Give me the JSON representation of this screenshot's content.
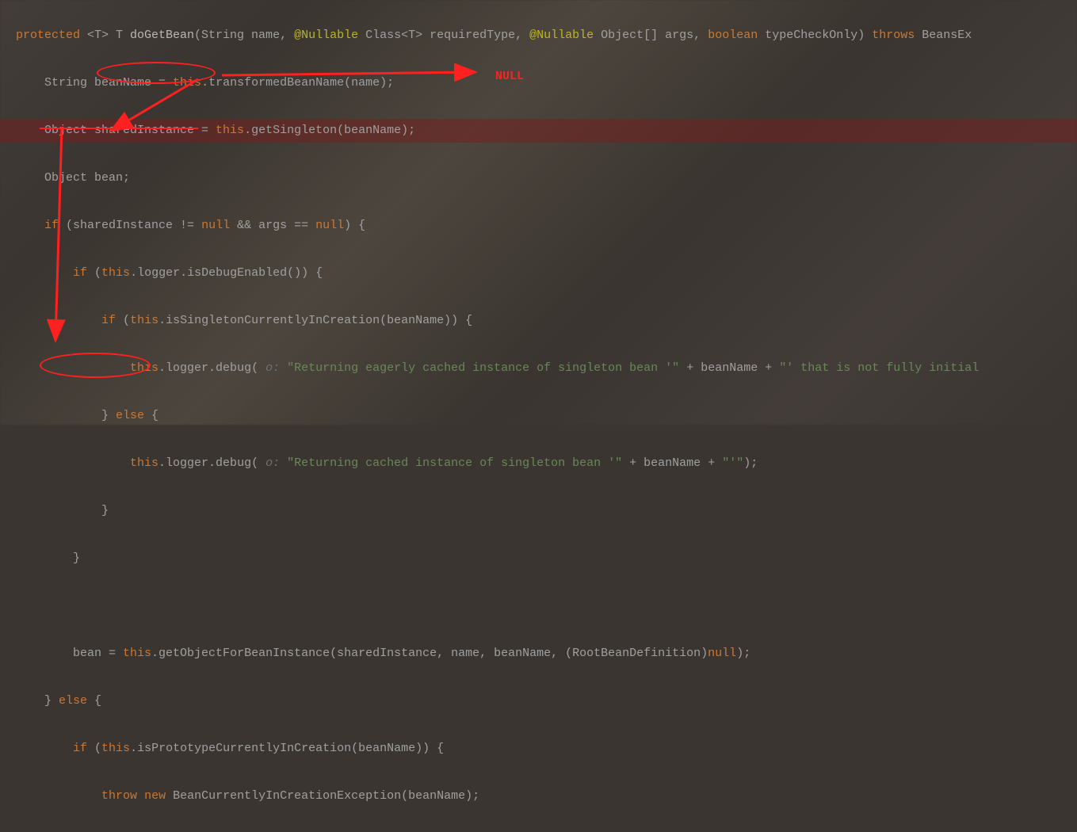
{
  "annotations": {
    "null_label": "NULL"
  },
  "code": {
    "l1": {
      "kw_protected": "protected",
      "gen_open": " <T> T ",
      "method": "doGetBean",
      "paren": "(String name, ",
      "ann1": "@Nullable",
      "p2": " Class<T> requiredType, ",
      "ann2": "@Nullable",
      "p3": " Object[] args, ",
      "kw_bool": "boolean",
      "p4": " typeCheckOnly) ",
      "kw_throws": "throws",
      "ex": " BeansEx"
    },
    "l2": {
      "pre": "    String beanName = ",
      "kw_this": "this",
      "rest": ".transformedBeanName(name);"
    },
    "l3": {
      "pre": "    Object sharedInstance = ",
      "kw_this": "this",
      "rest": ".getSingleton(beanName);"
    },
    "l4": {
      "txt": "    Object bean;"
    },
    "l5": {
      "pre": "    ",
      "kw_if": "if",
      "p1": " (sharedInstance != ",
      "kw_null": "null",
      "p2": " && args == ",
      "kw_null2": "null",
      "p3": ") {"
    },
    "l6": {
      "pre": "        ",
      "kw_if": "if",
      "p1": " (",
      "kw_this": "this",
      "rest": ".logger.isDebugEnabled()) {"
    },
    "l7": {
      "pre": "            ",
      "kw_if": "if",
      "p1": " (",
      "kw_this": "this",
      "rest": ".isSingletonCurrentlyInCreation(beanName)) {"
    },
    "l8": {
      "pre": "                ",
      "kw_this": "this",
      "p1": ".logger.debug(",
      "hint": " o: ",
      "str": "\"Returning eagerly cached instance of singleton bean '\"",
      "p2": " + beanName + ",
      "str2": "\"' that is not fully initial"
    },
    "l9": {
      "pre": "            } ",
      "kw_else": "else",
      "rest": " {"
    },
    "l10": {
      "pre": "                ",
      "kw_this": "this",
      "p1": ".logger.debug(",
      "hint": " o: ",
      "str": "\"Returning cached instance of singleton bean '\"",
      "p2": " + beanName + ",
      "str2": "\"'\"",
      "rest": ");"
    },
    "l11": {
      "txt": "            }"
    },
    "l12": {
      "txt": "        }"
    },
    "l13": {
      "txt": ""
    },
    "l14": {
      "pre": "        bean = ",
      "kw_this": "this",
      "p1": ".getObjectForBeanInstance(sharedInstance, name, beanName, (RootBeanDefinition)",
      "kw_null": "null",
      "rest": ");"
    },
    "l15": {
      "pre": "    } ",
      "kw_else": "else",
      "rest": " {"
    },
    "l16": {
      "pre": "        ",
      "kw_if": "if",
      "p1": " (",
      "kw_this": "this",
      "rest": ".isPrototypeCurrentlyInCreation(beanName)) {"
    },
    "l17": {
      "pre": "            ",
      "kw_throw": "throw",
      "sp": " ",
      "kw_new": "new",
      "rest": " BeanCurrentlyInCreationException(beanName);"
    }
  }
}
